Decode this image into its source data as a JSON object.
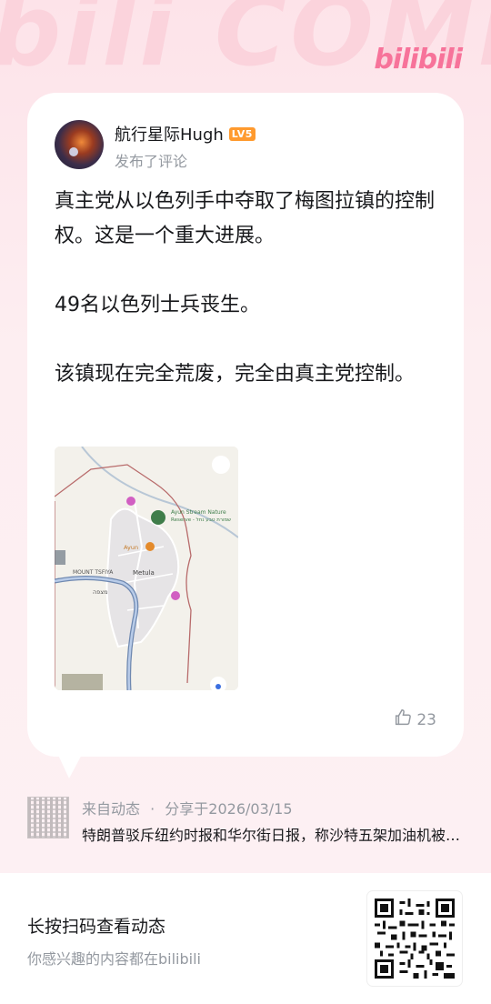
{
  "brand": {
    "watermark": "bili COMMENT",
    "logo": "bilibili",
    "accent": "#f7739a"
  },
  "post": {
    "username": "航行星际Hugh",
    "level_badge": "LV5",
    "action": "发布了评论",
    "content": [
      "真主党从以色列手中夺取了梅图拉镇的控制权。这是一个重大进展。",
      "49名以色列士兵丧生。",
      "该镇现在完全荒废，完全由真主党控制。"
    ],
    "likes": "23"
  },
  "map": {
    "labels": {
      "reserve": "Ayun Stream Nature",
      "reserve2": "Reserve - שמורת טבע נחל",
      "ayun": "Ayun",
      "mount": "MOUNT TSFIYA",
      "metula": "Metula",
      "hebrew": "מצפה"
    }
  },
  "source": {
    "origin": "来自动态",
    "separator": "·",
    "share_date": "分享于2026/03/15",
    "title": "特朗普驳斥纽约时报和华尔街日报，称沙特五架加油机被炸毁"
  },
  "footer": {
    "title": "长按扫码查看动态",
    "subtitle": "你感兴趣的内容都在bilibili"
  }
}
